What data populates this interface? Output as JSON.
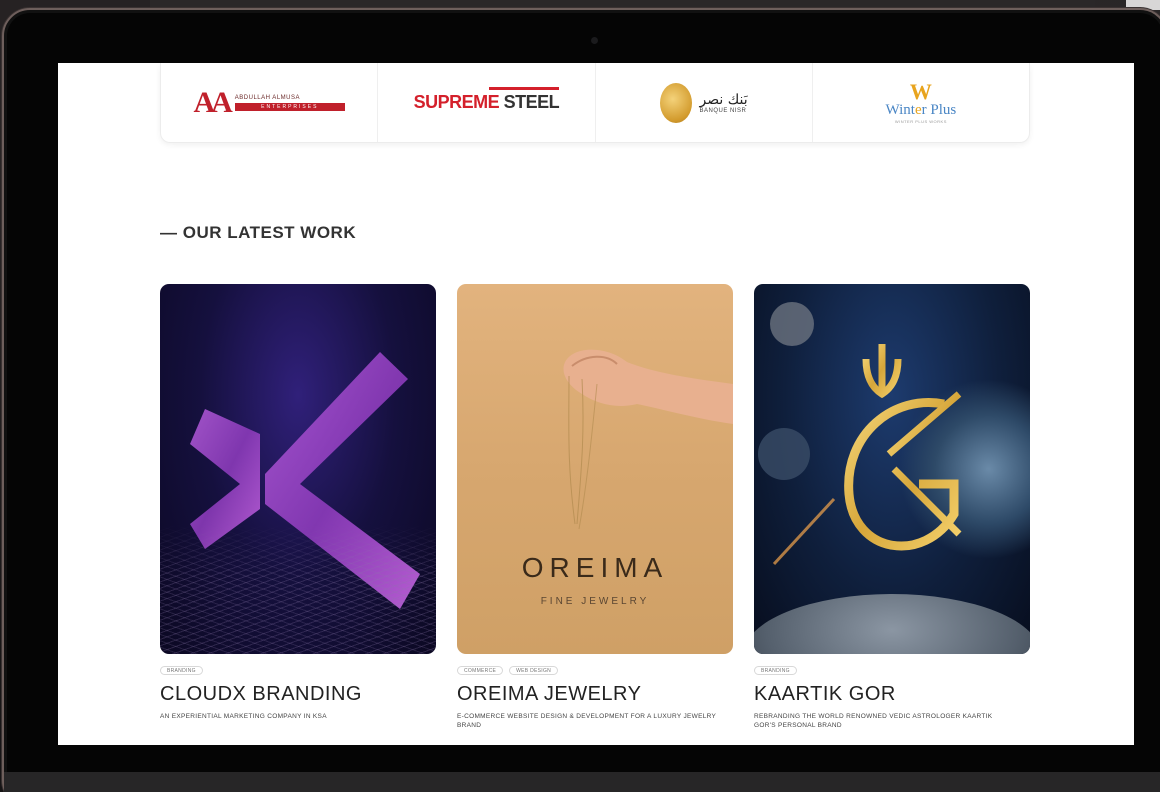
{
  "logos": [
    {
      "name": "Abdullah Almusa Enterprises",
      "mark": "AA",
      "top_text": "ABDULLAH ALMUSA",
      "bar_text": "ENTERPRISES"
    },
    {
      "name": "Supreme Steel",
      "red": "SUPREME",
      "dark": "STEEL"
    },
    {
      "name": "Bank Nisr",
      "arabic": "بَنك نصر",
      "english": "BANQUE NISR"
    },
    {
      "name": "Winter Plus",
      "mark": "W",
      "title_a": "Wint",
      "title_o": "e",
      "title_b": "r Plus",
      "sub": "WINTER PLUS WORKS"
    }
  ],
  "section": {
    "title": "— OUR LATEST WORK"
  },
  "projects": [
    {
      "tags": [
        "BRANDING"
      ],
      "title": "CLOUDX BRANDING",
      "description": "AN EXPERIENTIAL MARKETING COMPANY IN KSA"
    },
    {
      "tags": [
        "COMMERCE",
        "WEB DESIGN"
      ],
      "image_title": "OREIMA",
      "image_subtitle": "FINE JEWELRY",
      "title": "OREIMA JEWELRY",
      "description": "E-COMMERCE WEBSITE DESIGN & DEVELOPMENT FOR A LUXURY JEWELRY BRAND"
    },
    {
      "tags": [
        "BRANDING"
      ],
      "title": "KAARTIK GOR",
      "description": "REBRANDING THE WORLD RENOWNED VEDIC ASTROLOGER KAARTIK GOR'S PERSONAL BRAND"
    }
  ],
  "colors": {
    "brand_red": "#c0202b",
    "gold": "#e8a41e",
    "text_dark": "#222222"
  }
}
